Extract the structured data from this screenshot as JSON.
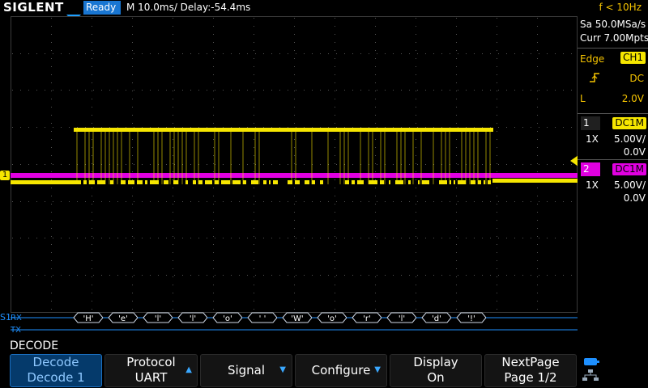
{
  "header": {
    "brand": "SIGLENT",
    "status": "Ready",
    "timebase": "M 10.0ms/ Delay:-54.4ms",
    "frequency": "f < 10Hz"
  },
  "acquisition": {
    "sample_rate": "Sa 50.0MSa/s",
    "points": "Curr 7.00Mpts"
  },
  "trigger": {
    "mode": "Edge",
    "source": "CH1",
    "coupling": "DC",
    "slope_icon": "rising-edge-icon",
    "level_label": "L",
    "level": "2.0V"
  },
  "channels": [
    {
      "number": "1",
      "coupling": "DC1M",
      "probe": "1X",
      "scale": "5.00V/",
      "offset": "0.0V",
      "color": "#f6e600"
    },
    {
      "number": "2",
      "coupling": "DC1M",
      "probe": "1X",
      "scale": "5.00V/",
      "offset": "0.0V",
      "color": "#e100e1"
    }
  ],
  "decode": {
    "bus_label": "S1",
    "rx_label": "RX",
    "tx_label": "TX",
    "rx_bytes": [
      "'H'",
      "'e'",
      "'l'",
      "'l'",
      "'o'",
      "' '",
      "'W'",
      "'o'",
      "'r'",
      "'l'",
      "'d'",
      "'!'"
    ],
    "color": "#1e90ff"
  },
  "markers": {
    "ch1": "1"
  },
  "menu": {
    "title": "DECODE",
    "softkeys": [
      {
        "line1": "Decode",
        "line2": "Decode 1",
        "active": true,
        "arrow": ""
      },
      {
        "line1": "Protocol",
        "line2": "UART",
        "active": false,
        "arrow": "up"
      },
      {
        "line1": "Signal",
        "line2": "",
        "active": false,
        "arrow": "down"
      },
      {
        "line1": "Configure",
        "line2": "",
        "active": false,
        "arrow": "down"
      },
      {
        "line1": "Display",
        "line2": "On",
        "active": false,
        "arrow": ""
      },
      {
        "line1": "NextPage",
        "line2": "Page 1/2",
        "active": false,
        "arrow": ""
      }
    ]
  }
}
